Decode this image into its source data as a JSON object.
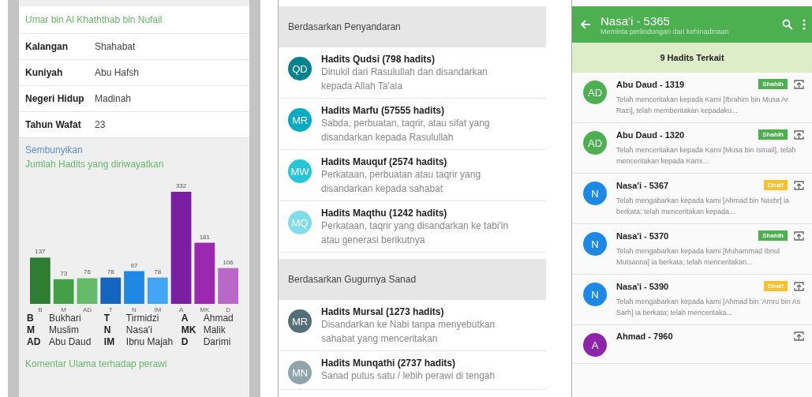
{
  "profile": {
    "name": "Umar bin Al Khaththab bin Nufail",
    "fields": [
      {
        "label": "Kalangan",
        "value": "Shahabat"
      },
      {
        "label": "Kuniyah",
        "value": "Abu Hafsh"
      },
      {
        "label": "Negeri Hidup",
        "value": "Madinah"
      },
      {
        "label": "Tahun Wafat",
        "value": "23"
      }
    ],
    "hide_link": "Sembunyikan",
    "chart_heading": "Jumlah Hadits yang diriwayatkan",
    "chart_data": {
      "type": "bar",
      "categories": [
        "B",
        "M",
        "AD",
        "T",
        "N",
        "IM",
        "A",
        "MK",
        "D"
      ],
      "series": [
        {
          "name": "Bukhari",
          "color": "#2e7d32",
          "values": [
            137,
            null,
            null,
            null,
            null,
            null,
            null,
            null,
            null
          ]
        },
        {
          "name": "Muslim",
          "color": "#43a047",
          "values": [
            null,
            73,
            null,
            null,
            null,
            null,
            null,
            null,
            null
          ]
        },
        {
          "name": "Abu Daud",
          "color": "#66bb6a",
          "values": [
            null,
            null,
            76,
            null,
            null,
            null,
            null,
            null,
            null
          ]
        },
        {
          "name": "Tirmidzi",
          "color": "#1565c0",
          "values": [
            null,
            null,
            null,
            78,
            null,
            null,
            null,
            null,
            null
          ]
        },
        {
          "name": "Nasa'i",
          "color": "#1e88e5",
          "values": [
            null,
            null,
            null,
            null,
            97,
            null,
            null,
            null,
            null
          ]
        },
        {
          "name": "Ibnu Majah",
          "color": "#42a5f5",
          "values": [
            null,
            null,
            null,
            null,
            null,
            78,
            null,
            null,
            null
          ]
        },
        {
          "name": "Ahmad",
          "color": "#7b1fa2",
          "values": [
            null,
            null,
            null,
            null,
            null,
            null,
            332,
            null,
            null
          ]
        },
        {
          "name": "Malik",
          "color": "#9c27b0",
          "values": [
            null,
            null,
            null,
            null,
            null,
            null,
            null,
            181,
            null
          ]
        },
        {
          "name": "Darimi",
          "color": "#ba68c8",
          "values": [
            null,
            null,
            null,
            null,
            null,
            null,
            null,
            null,
            106
          ]
        }
      ],
      "stacked": true,
      "data_labels": true
    },
    "comment_heading": "Komentar Ulama terhadap perawi"
  },
  "categories": {
    "sections": [
      {
        "title": "Berdasarkan Penyandaran",
        "items": [
          {
            "initials": "QD",
            "color": "#00838f",
            "title": "Hadits Qudsi (798 hadits)",
            "description": "Dinukil dari Rasulullah dan disandarkan kepada Allah Ta'ala"
          },
          {
            "initials": "MR",
            "color": "#00acc1",
            "title": "Hadits Marfu (57555 hadits)",
            "description": "Sabda, perbuatan, taqrir, atau sifat yang disandarkan kepada Rasulullah"
          },
          {
            "initials": "MW",
            "color": "#26c6da",
            "title": "Hadits Mauquf (2574 hadits)",
            "description": "Perkataan, perbuatan atau taqrir yang disandarkan kepada sahabat"
          },
          {
            "initials": "MQ",
            "color": "#80deea",
            "title": "Hadits Maqthu (1242 hadits)",
            "description": "Perkataan, taqrir yang disandarkan ke tabi'in atau generasi berikutnya"
          }
        ]
      },
      {
        "title": "Berdasarkan Gugurnya Sanad",
        "items": [
          {
            "initials": "MR",
            "color": "#546e7a",
            "title": "Hadits Mursal (1273 hadits)",
            "description": "Disandarkan ke Nabi tanpa menyebutkan sahabat yang menceritakan"
          },
          {
            "initials": "MN",
            "color": "#90a4ae",
            "title": "Hadits Munqathi (2737 hadits)",
            "description": "Sanad putus satu / lebih perawi di tengah"
          }
        ]
      }
    ]
  },
  "related": {
    "title": "Nasa'i - 5365",
    "subtitle": "Meminta perlindungan dari kehinadinaan",
    "count_heading": "9 Hadits Terkait",
    "items": [
      {
        "initials": "AD",
        "color": "#4caf50",
        "title": "Abu Daud - 1319",
        "grade": "Shahih",
        "kind": "shahih",
        "text": "Telah menceritakan kepada Kami [Ibrahim bin Musa Ar Razi], telah memberitakan kepadaku..."
      },
      {
        "initials": "AD",
        "color": "#4caf50",
        "title": "Abu Daud - 1320",
        "grade": "Shahih",
        "kind": "shahih",
        "text": "Telah menceritakan kepada Kami [Musa bin Ismail], telah menceritakan kepada Kami..."
      },
      {
        "initials": "N",
        "color": "#1e88e5",
        "title": "Nasa'i - 5367",
        "grade": "Dhaif",
        "kind": "dhaif",
        "text": "Telah mengabarkan kepada kami [Ahmad bin Nashr] ia berkata; telah menceritakan kepada..."
      },
      {
        "initials": "N",
        "color": "#1e88e5",
        "title": "Nasa'i - 5370",
        "grade": "Shahih",
        "kind": "shahih",
        "text": "Telah mengabarkan kepada kami [Muhammad Ibnul Mutsanna] ia berkata; telah menceritakan..."
      },
      {
        "initials": "N",
        "color": "#1e88e5",
        "title": "Nasa'i - 5390",
        "grade": "Dhaif",
        "kind": "dhaif",
        "text": "Telah mengabarkan kepada kami [Ahmad bin 'Amru bin As Sarh] ia berkata; telah menceritaka..."
      },
      {
        "initials": "A",
        "color": "#8e24aa",
        "title": "Ahmad - 7960",
        "kind": "none"
      }
    ]
  }
}
